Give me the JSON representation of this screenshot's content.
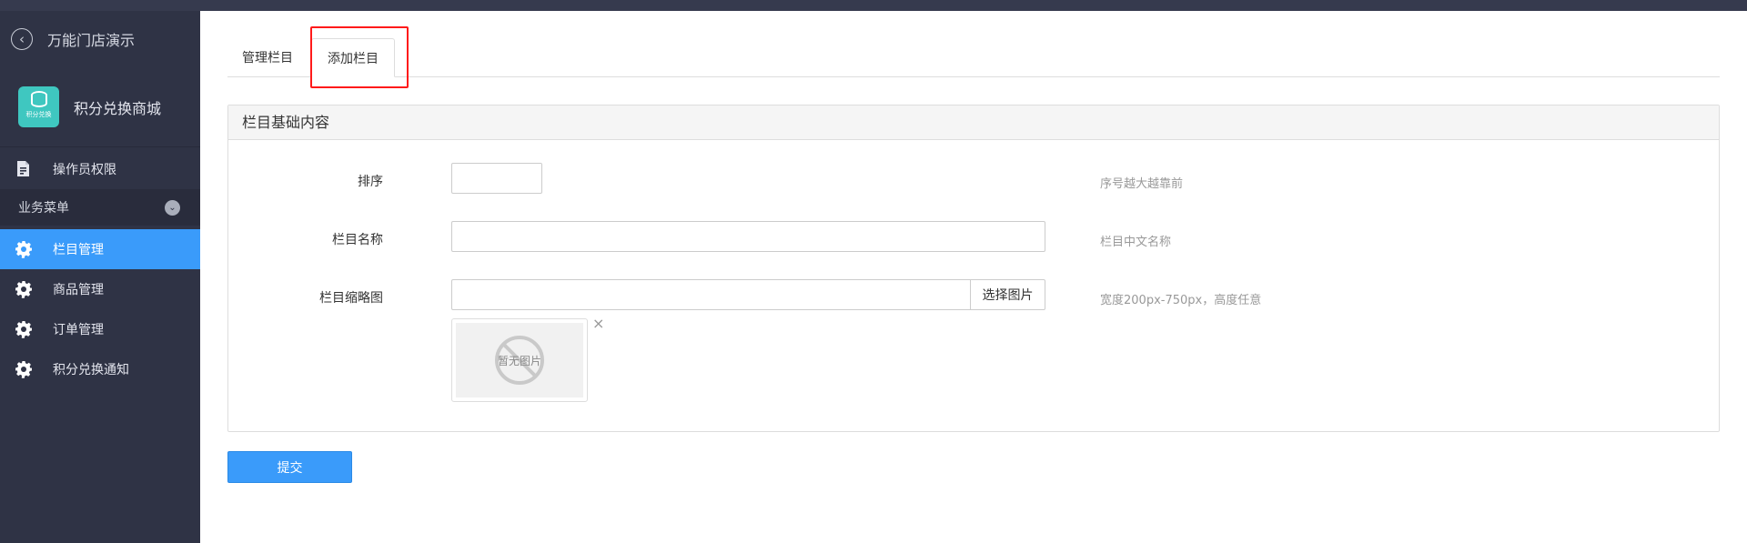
{
  "sidebar": {
    "back_label": "万能门店演示",
    "app_name": "积分兑换商城",
    "app_logo_text": "积分兑换",
    "permission_label": "操作员权限",
    "group_label": "业务菜单",
    "items": [
      {
        "label": "栏目管理",
        "active": true
      },
      {
        "label": "商品管理",
        "active": false
      },
      {
        "label": "订单管理",
        "active": false
      },
      {
        "label": "积分兑换通知",
        "active": false
      }
    ]
  },
  "tabs": [
    {
      "label": "管理栏目",
      "active": false
    },
    {
      "label": "添加栏目",
      "active": true
    }
  ],
  "panel": {
    "title": "栏目基础内容",
    "fields": {
      "sort": {
        "label": "排序",
        "value": "",
        "hint": "序号越大越靠前"
      },
      "name": {
        "label": "栏目名称",
        "value": "",
        "hint": "栏目中文名称"
      },
      "thumb": {
        "label": "栏目缩略图",
        "value": "",
        "button": "选择图片",
        "hint": "宽度200px-750px，高度任意",
        "placeholder_text": "暂无图片",
        "remove": "×"
      }
    }
  },
  "submit_label": "提交",
  "colors": {
    "sidebar_bg": "#2f3345",
    "accent": "#3a9bfa",
    "highlight": "#ff1a1a"
  }
}
